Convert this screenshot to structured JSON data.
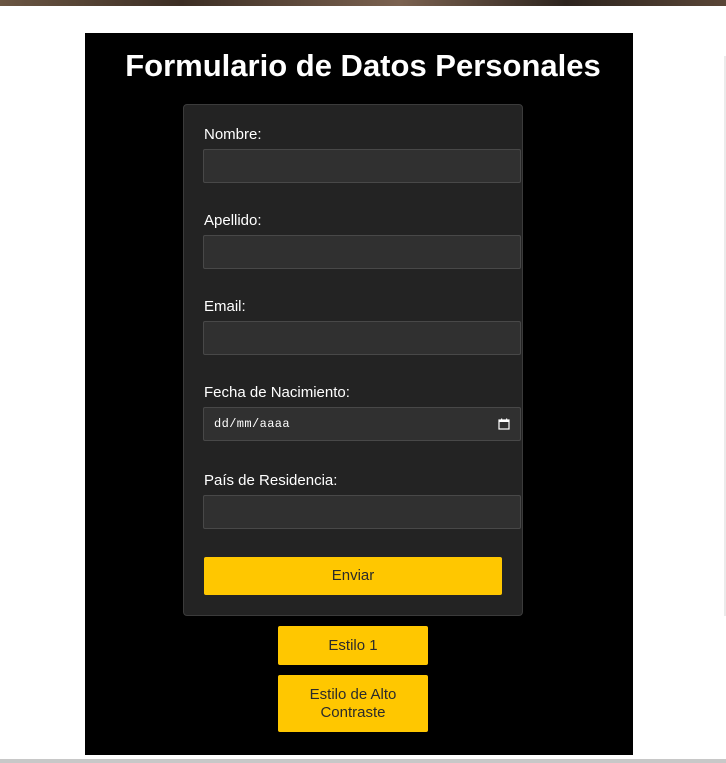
{
  "page": {
    "title": "Formulario de Datos Personales"
  },
  "form": {
    "fields": [
      {
        "label": "Nombre:",
        "value": "",
        "placeholder": ""
      },
      {
        "label": "Apellido:",
        "value": "",
        "placeholder": ""
      },
      {
        "label": "Email:",
        "value": "",
        "placeholder": ""
      },
      {
        "label": "Fecha de Nacimiento:",
        "value": "dd/mm/aaaa",
        "placeholder": "dd/mm/aaaa"
      },
      {
        "label": "País de Residencia:",
        "value": "",
        "placeholder": ""
      }
    ],
    "submit_label": "Enviar"
  },
  "style_buttons": {
    "style1_label": "Estilo 1",
    "contrast_label": "Estilo de Alto Contraste"
  },
  "icons": {
    "date": "calendar-icon"
  },
  "colors": {
    "panel": "#000000",
    "card": "#232323",
    "input": "#303030",
    "button": "#ffc700",
    "text": "#ffffff"
  }
}
